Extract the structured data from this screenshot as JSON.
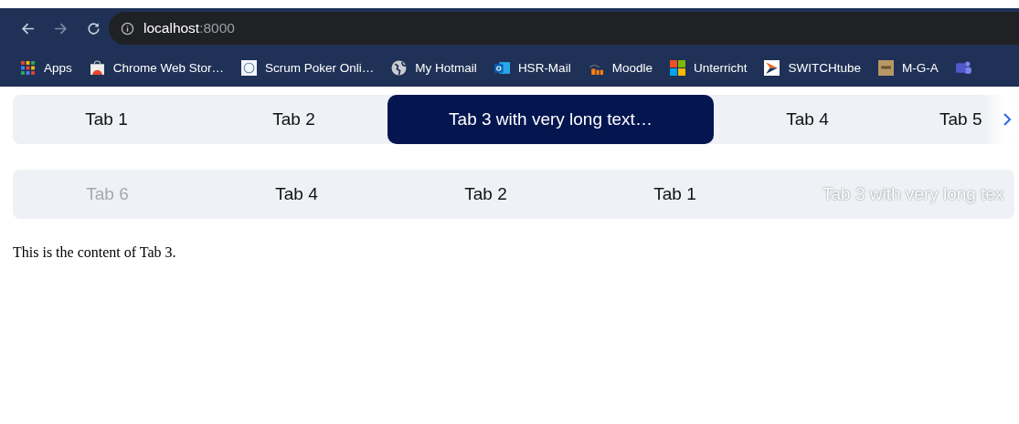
{
  "browser": {
    "url_host": "localhost",
    "url_port": ":8000",
    "bookmarks": [
      {
        "label": "Apps",
        "kind": "apps"
      },
      {
        "label": "Chrome Web Stor…",
        "kind": "store"
      },
      {
        "label": "Scrum Poker Onli…",
        "kind": "poker"
      },
      {
        "label": "My Hotmail",
        "kind": "globe"
      },
      {
        "label": "HSR-Mail",
        "kind": "outlook"
      },
      {
        "label": "Moodle",
        "kind": "moodle"
      },
      {
        "label": "Unterricht",
        "kind": "windows"
      },
      {
        "label": "SWITCHtube",
        "kind": "play"
      },
      {
        "label": "M-G-A",
        "kind": "box"
      },
      {
        "kind": "teams"
      }
    ]
  },
  "tab_bar": {
    "tabs": [
      {
        "label": "Tab 1",
        "selected": false
      },
      {
        "label": "Tab 2",
        "selected": false
      },
      {
        "label": "Tab 3 with very long text…",
        "selected": true
      },
      {
        "label": "Tab 4",
        "selected": false
      },
      {
        "label": "Tab 5",
        "selected": false
      }
    ]
  },
  "reorder_bar": {
    "tabs": [
      {
        "label": "Tab 6",
        "disabled": true,
        "kind": "tab"
      },
      {
        "label": "Tab 4",
        "disabled": false,
        "kind": "tab"
      },
      {
        "label": "Tab 2",
        "disabled": false,
        "kind": "tab"
      },
      {
        "label": "Tab 1",
        "disabled": false,
        "kind": "tab"
      },
      {
        "label": "Tab 3 with very long tex",
        "kind": "ghost"
      }
    ]
  },
  "content": "This is the content of Tab 3."
}
